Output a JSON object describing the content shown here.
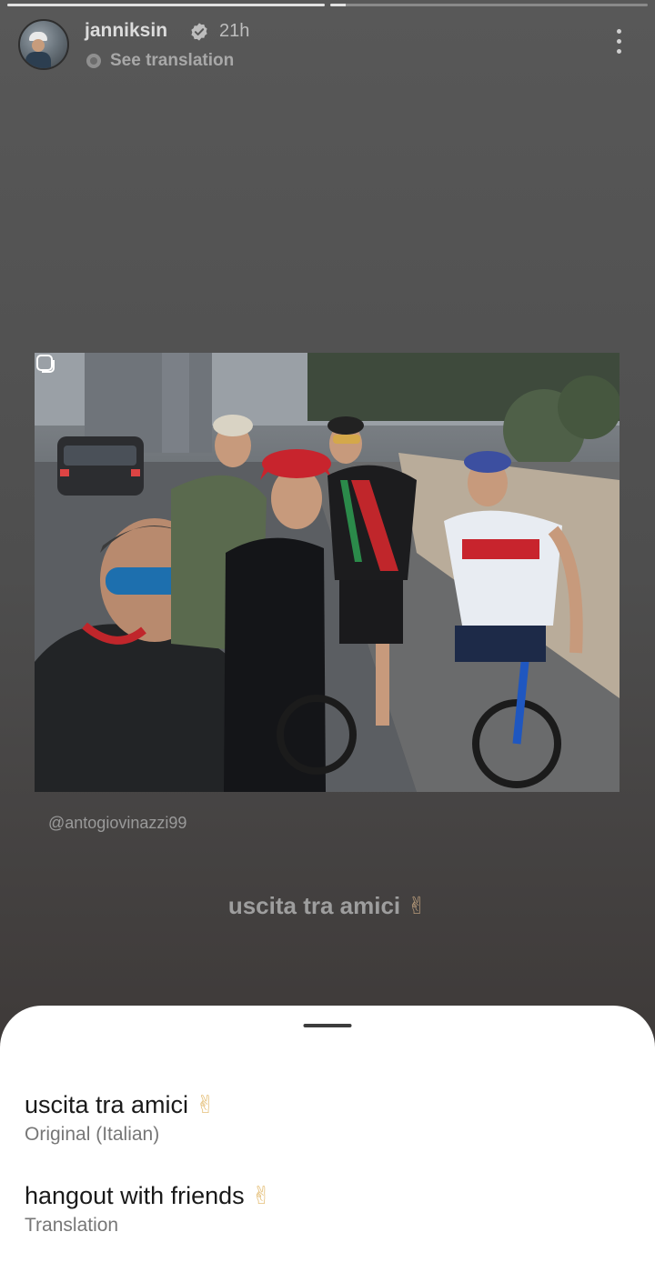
{
  "story": {
    "progress": [
      1.0,
      0.05
    ]
  },
  "header": {
    "username": "janniksin",
    "time_ago": "21h",
    "see_translation": "See translation"
  },
  "post": {
    "credit": "@antogiovinazzi99"
  },
  "caption": {
    "text": "uscita tra amici",
    "emoji": "✌"
  },
  "translation_sheet": {
    "original_text": "uscita tra amici",
    "original_emoji": "✌",
    "original_label": "Original (Italian)",
    "translated_text": "hangout with friends",
    "translated_emoji": "✌",
    "translated_label": "Translation"
  },
  "colors": {
    "background": "#4e4e4e",
    "sheet": "#ffffff",
    "text_primary": "#1a1a1a",
    "text_secondary": "#777777"
  }
}
